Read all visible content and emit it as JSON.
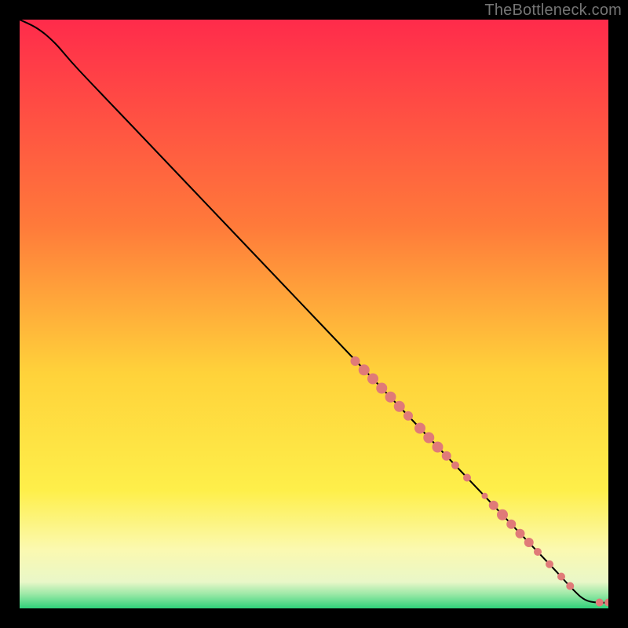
{
  "watermark": "TheBottleneck.com",
  "chart_data": {
    "type": "line",
    "title": "",
    "xlabel": "",
    "ylabel": "",
    "xlim": [
      0,
      100
    ],
    "ylim": [
      0,
      100
    ],
    "background_gradient": [
      {
        "stop": 0.0,
        "color": "#ff2b4b"
      },
      {
        "stop": 0.35,
        "color": "#ff7a3a"
      },
      {
        "stop": 0.6,
        "color": "#ffd23a"
      },
      {
        "stop": 0.8,
        "color": "#feef4a"
      },
      {
        "stop": 0.9,
        "color": "#fbf9b0"
      },
      {
        "stop": 0.955,
        "color": "#e9f7c8"
      },
      {
        "stop": 0.975,
        "color": "#9fe9a8"
      },
      {
        "stop": 1.0,
        "color": "#2fd27a"
      }
    ],
    "curve": [
      {
        "x": 0.0,
        "y": 100.0
      },
      {
        "x": 3.0,
        "y": 98.5
      },
      {
        "x": 6.0,
        "y": 96.0
      },
      {
        "x": 10.0,
        "y": 91.5
      },
      {
        "x": 20.0,
        "y": 81.0
      },
      {
        "x": 30.0,
        "y": 70.5
      },
      {
        "x": 40.0,
        "y": 60.0
      },
      {
        "x": 50.0,
        "y": 49.5
      },
      {
        "x": 60.0,
        "y": 39.0
      },
      {
        "x": 70.0,
        "y": 28.5
      },
      {
        "x": 80.0,
        "y": 18.0
      },
      {
        "x": 90.0,
        "y": 7.5
      },
      {
        "x": 94.0,
        "y": 3.2
      },
      {
        "x": 96.0,
        "y": 1.5
      },
      {
        "x": 98.0,
        "y": 1.0
      },
      {
        "x": 100.0,
        "y": 1.0
      }
    ],
    "marker_color": "#e07a78",
    "markers": [
      {
        "x": 57.0,
        "y": 42.0,
        "r": 6
      },
      {
        "x": 58.5,
        "y": 40.5,
        "r": 7
      },
      {
        "x": 60.0,
        "y": 39.0,
        "r": 7
      },
      {
        "x": 61.5,
        "y": 37.4,
        "r": 7
      },
      {
        "x": 63.0,
        "y": 35.9,
        "r": 7
      },
      {
        "x": 64.5,
        "y": 34.3,
        "r": 7
      },
      {
        "x": 66.0,
        "y": 32.7,
        "r": 6
      },
      {
        "x": 68.0,
        "y": 30.6,
        "r": 7
      },
      {
        "x": 69.5,
        "y": 29.0,
        "r": 7
      },
      {
        "x": 71.0,
        "y": 27.4,
        "r": 7
      },
      {
        "x": 72.5,
        "y": 25.9,
        "r": 6
      },
      {
        "x": 74.0,
        "y": 24.3,
        "r": 5
      },
      {
        "x": 76.0,
        "y": 22.2,
        "r": 5
      },
      {
        "x": 79.0,
        "y": 19.1,
        "r": 4
      },
      {
        "x": 80.5,
        "y": 17.5,
        "r": 6
      },
      {
        "x": 82.0,
        "y": 15.9,
        "r": 7
      },
      {
        "x": 83.5,
        "y": 14.3,
        "r": 6
      },
      {
        "x": 85.0,
        "y": 12.7,
        "r": 6
      },
      {
        "x": 86.5,
        "y": 11.2,
        "r": 6
      },
      {
        "x": 88.0,
        "y": 9.6,
        "r": 5
      },
      {
        "x": 90.0,
        "y": 7.5,
        "r": 5
      },
      {
        "x": 92.0,
        "y": 5.4,
        "r": 5
      },
      {
        "x": 93.5,
        "y": 3.8,
        "r": 5
      },
      {
        "x": 98.5,
        "y": 1.0,
        "r": 5
      },
      {
        "x": 100.0,
        "y": 1.0,
        "r": 5
      }
    ]
  }
}
